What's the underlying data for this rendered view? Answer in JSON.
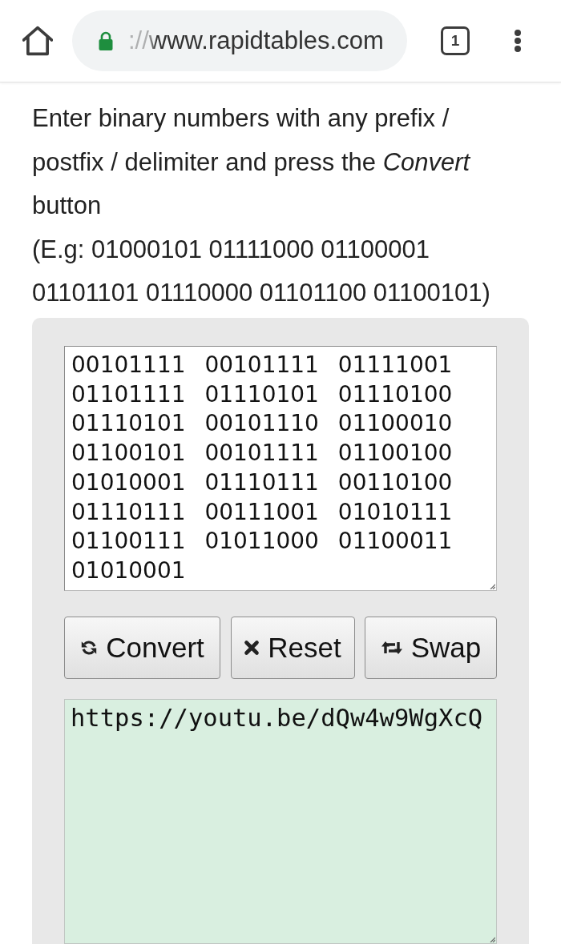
{
  "browser_bar": {
    "secure": true,
    "url": "://www.rapidtables.com",
    "tab_count": "1"
  },
  "instructions": "Enter binary numbers with any prefix / postfix / delimiter and press the *Convert* button",
  "example": "(E.g: 01000101 01111000 01100001 01101101 01110000 01101100 01100101)",
  "converter": {
    "input": {
      "value": "00101111 00101111 01111001 01101111 01110101 01110100 01110101 00101110 01100010 01100101 00101111 01100100 01010001 01110111 00110100 01110111 00111001 01010111 01100111 01011000 01100011 01010001"
    },
    "buttons": [
      {
        "kind": "convert",
        "label": "Convert"
      },
      {
        "kind": "reset",
        "label": "Reset"
      },
      {
        "kind": "swap",
        "label": "Swap"
      }
    ],
    "output": {
      "value": "https://youtu.be/dQw4w9WgXcQ"
    }
  }
}
